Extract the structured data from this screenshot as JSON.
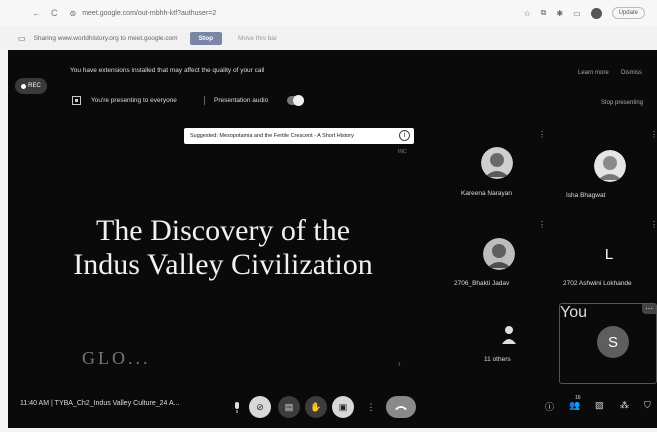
{
  "browser": {
    "back": "←",
    "reload": "C",
    "url": "meet.google.com/out-mbhh-ktf?authuser=2",
    "update_label": "Update"
  },
  "share_bar": {
    "text": "Sharing www.worldhistory.org to meet.google.com",
    "stop_label": "Stop",
    "hide_label": "Move this bar"
  },
  "meet": {
    "rec_label": "REC",
    "extension_warning": "You have extensions installed that may affect the quality of your call",
    "learn_more": "Learn more",
    "dismiss": "Dismiss",
    "presenting_text": "You're presenting to everyone",
    "presentation_audio": "Presentation audio",
    "presentation_audio_on": true,
    "stop_presenting": "Stop presenting",
    "suggestion": "Suggested: Mesopotamia and the Fertile Crescent - A Short History",
    "suggestion_tail": "INC",
    "slide": {
      "title_line1": "The Discovery of the",
      "title_line2": "Indus Valley Civilization",
      "bottom_text": "GLO..."
    },
    "participants": [
      {
        "name": "Kareena Narayan",
        "avatar": "photo"
      },
      {
        "name": "Isha Bhagwat",
        "avatar": "photo"
      },
      {
        "name": "2706_Bhakti Jadav",
        "avatar": "photo"
      },
      {
        "name": "2702 Ashwini Lokhande",
        "avatar": "L"
      },
      {
        "name": "11 others",
        "avatar": "person-icon"
      },
      {
        "name": "You",
        "avatar": "S"
      }
    ],
    "bottom_bar": {
      "time": "11:40 AM",
      "separator": "|",
      "meeting_name": "TYBA_Ch2_Indus Valley Culture_24 A...",
      "people_count": "16"
    }
  },
  "colors": {
    "meet_bg": "#0a0a0a",
    "stop_button": "#7b86a6",
    "end_call": "#8a8a8a"
  }
}
